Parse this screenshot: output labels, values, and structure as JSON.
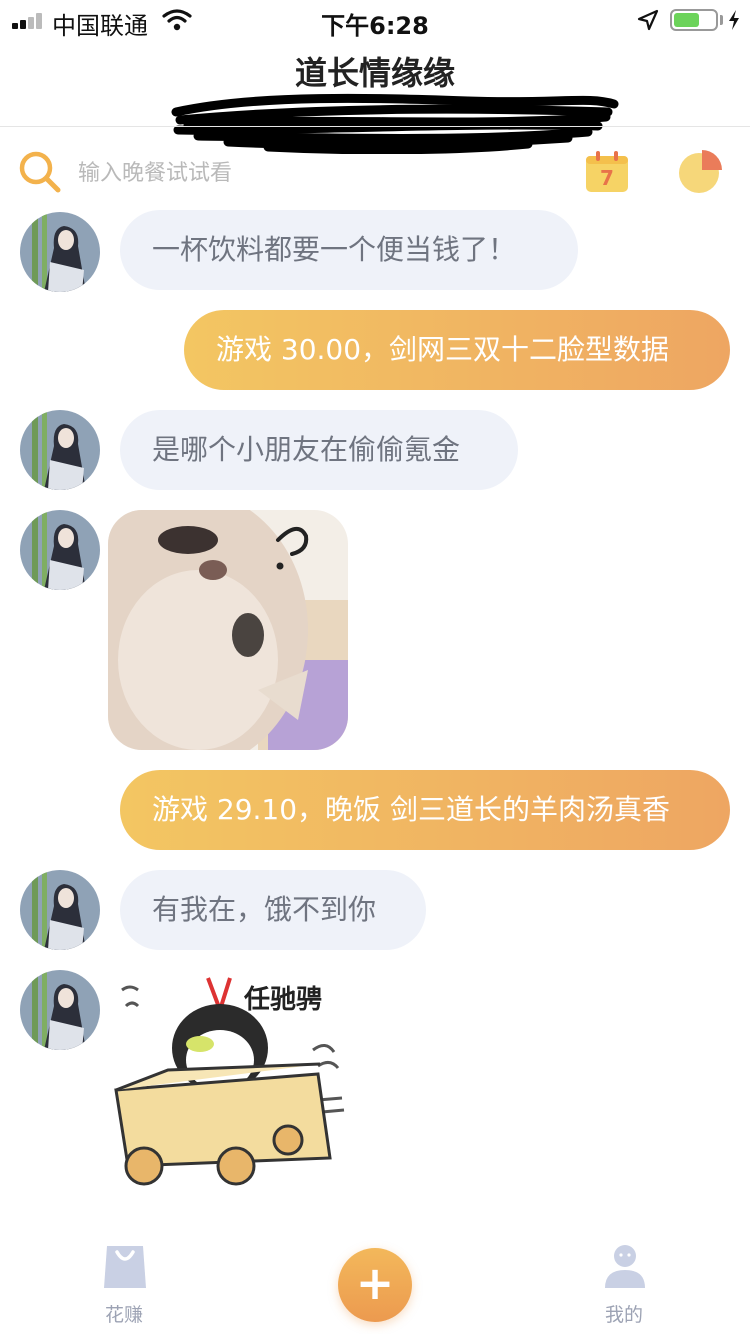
{
  "status_bar": {
    "carrier": "中国联通",
    "time": "下午6:28",
    "battery_level": 0.62
  },
  "nav": {
    "title": "道长情缘缘"
  },
  "search": {
    "placeholder": "输入晚餐试试看",
    "calendar_day": "7"
  },
  "messages": [
    {
      "side": "received",
      "type": "text",
      "text": "一杯饮料都要一个便当钱了！"
    },
    {
      "side": "sent",
      "type": "text",
      "text": "游戏 30.00，剑网三双十二脸型数据"
    },
    {
      "side": "received",
      "type": "text",
      "text": "是哪个小朋友在偷偷氪金"
    },
    {
      "side": "received",
      "type": "sticker",
      "sticker": "cat-question-sticker"
    },
    {
      "side": "sent",
      "type": "text",
      "text": "游戏 29.10，晚饭 剑三道长的羊肉汤真香"
    },
    {
      "side": "received",
      "type": "text",
      "text": "有我在，饿不到你"
    },
    {
      "side": "received",
      "type": "sticker",
      "sticker": "penguin-box-sticker",
      "caption": "任驰骋"
    }
  ],
  "tab_bar": {
    "items": [
      {
        "label": "花赚",
        "icon": "shopping-bag-icon"
      },
      {
        "label": "",
        "icon": "plus-icon"
      },
      {
        "label": "我的",
        "icon": "user-icon"
      }
    ]
  },
  "colors": {
    "accent_gradient_start": "#f3c662",
    "accent_gradient_end": "#eea662",
    "received_bubble": "#eff2f9",
    "received_text": "#6f7480",
    "tab_inactive": "#9da3b4"
  }
}
